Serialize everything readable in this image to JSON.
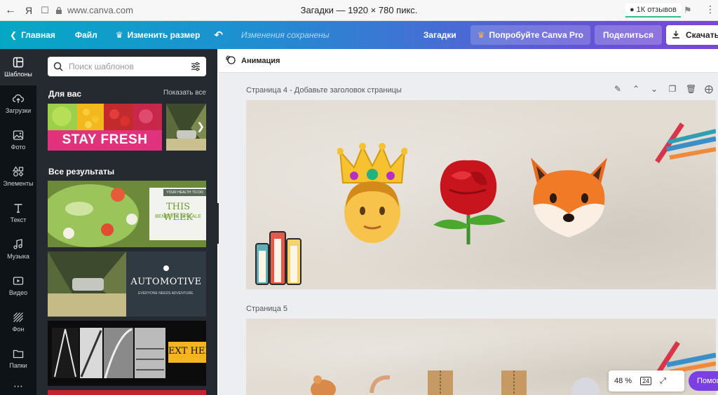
{
  "browser": {
    "back_icon": "back-arrow-icon",
    "yandex_logo": "Я",
    "url": "www.canva.com",
    "tab_title": "Загадки — 1920 × 780 пикс.",
    "reviews": "1К отзывов"
  },
  "toolbar": {
    "home": "Главная",
    "file": "Файл",
    "resize": "Изменить размер",
    "saved": "Изменения сохранены",
    "doc_title": "Загадки",
    "try_pro": "Попробуйте Canva Pro",
    "share": "Поделиться",
    "download": "Скачать"
  },
  "rail": {
    "items": [
      {
        "label": "Шаблоны",
        "icon": "templates-icon"
      },
      {
        "label": "Загрузки",
        "icon": "upload-icon"
      },
      {
        "label": "Фото",
        "icon": "photo-icon"
      },
      {
        "label": "Элементы",
        "icon": "elements-icon"
      },
      {
        "label": "Текст",
        "icon": "text-icon"
      },
      {
        "label": "Музыка",
        "icon": "music-icon"
      },
      {
        "label": "Видео",
        "icon": "video-icon"
      },
      {
        "label": "Фон",
        "icon": "background-icon"
      },
      {
        "label": "Папки",
        "icon": "folder-icon"
      }
    ]
  },
  "panel": {
    "search_placeholder": "Поиск шаблонов",
    "for_you": "Для вас",
    "show_all": "Показать все",
    "all_results": "Все результаты",
    "stay_fresh": "STAY FRESH",
    "health_tag": "YOUR HEALTH TO-DO",
    "this_week": "THIS WEEK",
    "benefits": "BENEFITS OF KALE",
    "automotive": "AUTOMOTIVE",
    "automotive_sub": "EVERYONE NEEDS ADVENTURE.",
    "ext_here": "EXT HER"
  },
  "editor": {
    "animation": "Анимация",
    "page4": "Страница 4 - Добавьте заголовок страницы",
    "page5": "Страница 5"
  },
  "zoom": {
    "value": "48 %",
    "pages": "24"
  },
  "help": "Помощь",
  "colors": {
    "rail_bg": "#0e1318",
    "panel_bg": "#252a31",
    "accent_purple": "#7b3fe4",
    "stay_fresh_pink": "#e0327d"
  }
}
